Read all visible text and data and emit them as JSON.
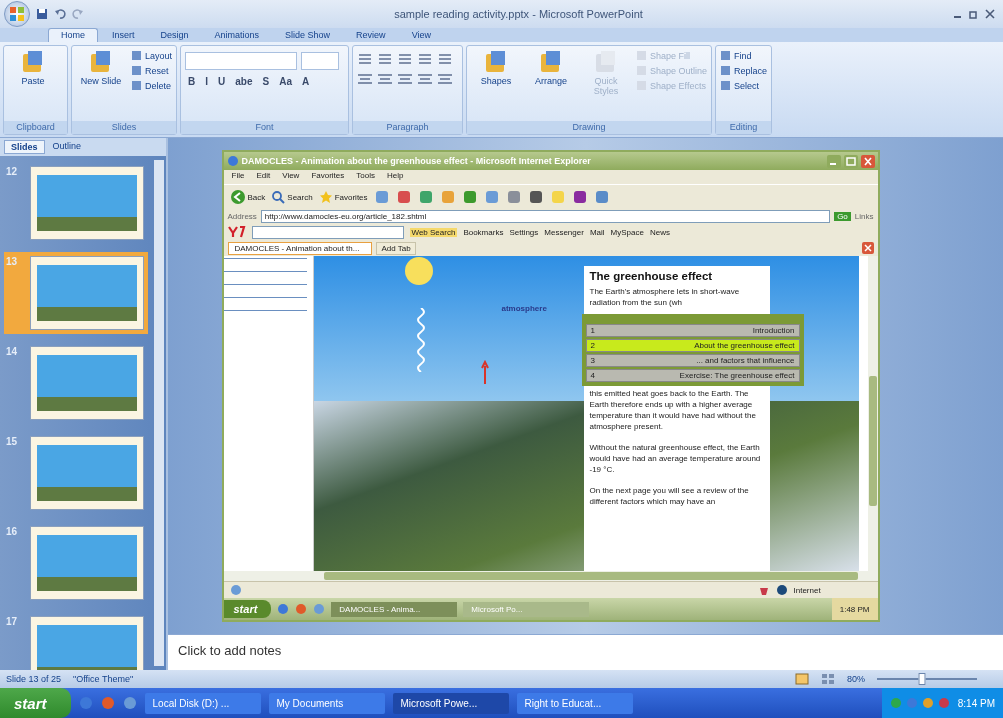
{
  "window": {
    "title": "sample reading activity.pptx - Microsoft PowerPoint"
  },
  "ribbon_tabs": [
    {
      "label": "Home",
      "selected": true
    },
    {
      "label": "Insert",
      "selected": false
    },
    {
      "label": "Design",
      "selected": false
    },
    {
      "label": "Animations",
      "selected": false
    },
    {
      "label": "Slide Show",
      "selected": false
    },
    {
      "label": "Review",
      "selected": false
    },
    {
      "label": "View",
      "selected": false
    }
  ],
  "ribbon_groups": [
    {
      "label": "Clipboard",
      "items": [
        {
          "kind": "large",
          "label": "Paste"
        }
      ]
    },
    {
      "label": "Slides",
      "items": [
        {
          "kind": "large",
          "label": "New Slide"
        },
        {
          "kind": "small",
          "label": "Layout"
        },
        {
          "kind": "small",
          "label": "Reset"
        },
        {
          "kind": "small",
          "label": "Delete"
        }
      ]
    },
    {
      "label": "Font",
      "items": [
        {
          "kind": "glyph",
          "label": "B"
        },
        {
          "kind": "glyph",
          "label": "I"
        },
        {
          "kind": "glyph",
          "label": "U"
        },
        {
          "kind": "glyph",
          "label": "abe"
        },
        {
          "kind": "glyph",
          "label": "S"
        },
        {
          "kind": "glyph",
          "label": "Aa"
        },
        {
          "kind": "glyph",
          "label": "A"
        }
      ]
    },
    {
      "label": "Paragraph"
    },
    {
      "label": "Drawing",
      "items": [
        {
          "kind": "large",
          "label": "Shapes"
        },
        {
          "kind": "large",
          "label": "Arrange"
        },
        {
          "kind": "large",
          "label": "Quick Styles",
          "disabled": true
        },
        {
          "kind": "small",
          "label": "Shape Fill",
          "disabled": true
        },
        {
          "kind": "small",
          "label": "Shape Outline",
          "disabled": true
        },
        {
          "kind": "small",
          "label": "Shape Effects",
          "disabled": true
        }
      ]
    },
    {
      "label": "Editing",
      "items": [
        {
          "kind": "small",
          "label": "Find"
        },
        {
          "kind": "small",
          "label": "Replace"
        },
        {
          "kind": "small",
          "label": "Select"
        }
      ]
    }
  ],
  "sidebar": {
    "tabs": [
      {
        "label": "Slides",
        "selected": true
      },
      {
        "label": "Outline",
        "selected": false
      }
    ],
    "slides": [
      {
        "number": "12",
        "selected": false
      },
      {
        "number": "13",
        "selected": true
      },
      {
        "number": "14",
        "selected": false
      },
      {
        "number": "15",
        "selected": false
      },
      {
        "number": "16",
        "selected": false
      },
      {
        "number": "17",
        "selected": false
      }
    ]
  },
  "browser": {
    "title": "DAMOCLES - Animation about the greenhouse effect - Microsoft Internet Explorer",
    "menu": [
      "File",
      "Edit",
      "View",
      "Favorites",
      "Tools",
      "Help"
    ],
    "toolbar": [
      "Back",
      "Search",
      "Favorites"
    ],
    "address_label": "Address",
    "url": "http://www.damocles-eu.org/article_182.shtml",
    "go": "Go",
    "links": "Links",
    "yahoo": [
      {
        "label": "Web Search",
        "selected": true
      },
      {
        "label": "Bookmarks",
        "selected": false
      },
      {
        "label": "Settings",
        "selected": false
      },
      {
        "label": "Messenger",
        "selected": false
      },
      {
        "label": "Mail",
        "selected": false
      },
      {
        "label": "MySpace",
        "selected": false
      },
      {
        "label": "News",
        "selected": false
      }
    ],
    "tab": "DAMOCLES - Animation about th...",
    "add_tab": "Add Tab",
    "diagram_label": "atmosphere",
    "article": {
      "heading": "The greenhouse effect",
      "paragraphs": [
        "The Earth's atmosphere lets in short-wave radiation from the sun (wh",
        "this emitted heat goes back to the Earth. The Earth therefore ends up with a higher average temperature than it would have had without the atmosphere present.",
        "Without the natural greenhouse effect, the Earth would have had an average temperature around -19 °C.",
        "On the next page you will see a review of the different factors which may have an"
      ]
    },
    "chapters": [
      {
        "number": "1",
        "label": "Introduction",
        "selected": false
      },
      {
        "number": "2",
        "label": "About the greenhouse effect",
        "selected": true
      },
      {
        "number": "3",
        "label": "... and factors that influence",
        "selected": false
      },
      {
        "number": "4",
        "label": "Exercise: The greenhouse effect",
        "selected": false
      }
    ],
    "status_zone": "Internet",
    "taskbar": {
      "start": "start",
      "tasks": [
        {
          "label": "DAMOCLES - Anima...",
          "selected": true
        },
        {
          "label": "Microsoft Po...",
          "selected": false
        }
      ],
      "clock": "1:48 PM"
    }
  },
  "notes": {
    "placeholder": "Click to add notes"
  },
  "status_bar": {
    "slide": "Slide 13 of 25",
    "theme": "\"Office Theme\"",
    "zoom": "80%",
    "level": 0.45
  },
  "taskbar": {
    "start": "start",
    "tasks": [
      {
        "label": "Local Disk (D:) ...",
        "selected": false
      },
      {
        "label": "My Documents",
        "selected": false
      },
      {
        "label": "Microsoft Powe...",
        "selected": true
      },
      {
        "label": "Right to Educat...",
        "selected": false
      }
    ],
    "clock": "8:14 PM"
  }
}
